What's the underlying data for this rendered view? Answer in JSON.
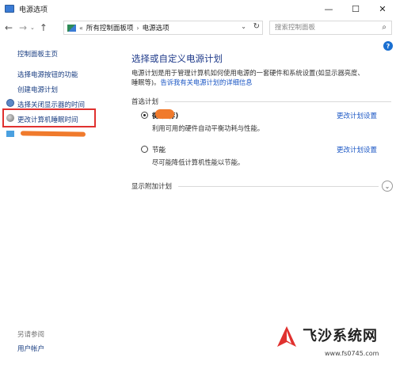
{
  "window": {
    "title": "电源选项",
    "controls": {
      "minimize": "—",
      "maximize": "☐",
      "close": "✕"
    }
  },
  "navbar": {
    "back": "←",
    "forward": "→",
    "recent": "⌄",
    "up": "↑",
    "breadcrumb_prefix": "«",
    "breadcrumb": [
      "所有控制面板项",
      "电源选项"
    ],
    "breadcrumb_sep": "›",
    "dropdown": "⌄",
    "refresh": "↻",
    "search_placeholder": "搜索控制面板"
  },
  "help": "?",
  "sidebar": {
    "home": "控制面板主页",
    "items": [
      "选择电源按钮的功能",
      "创建电源计划",
      "选择关闭显示器的时间",
      "更改计算机睡眠时间"
    ],
    "see_also": "另请参阅",
    "user_accounts": "用户帐户"
  },
  "main": {
    "title": "选择或自定义电源计划",
    "description": "电源计划是用于管理计算机如何使用电源的一套硬件和系统设置(如显示器亮度、睡眠等)。",
    "description_link": "告诉我有关电源计划的详细信息",
    "preferred_label": "首选计划",
    "plans": [
      {
        "name": "衡(推荐)",
        "desc": "利用可用的硬件自动平衡功耗与性能。",
        "settings": "更改计划设置",
        "selected": true
      },
      {
        "name": "节能",
        "desc": "尽可能降低计算机性能以节能。",
        "settings": "更改计划设置",
        "selected": false
      }
    ],
    "show_more": "显示附加计划",
    "expand": "⌄"
  },
  "watermark": {
    "name": "飞沙系统网",
    "url": "www.fs0745.com"
  },
  "colors": {
    "link": "#1a56c4",
    "title": "#1e3a8a",
    "highlight_box": "#e0312f",
    "scribble": "#f07a2c"
  }
}
